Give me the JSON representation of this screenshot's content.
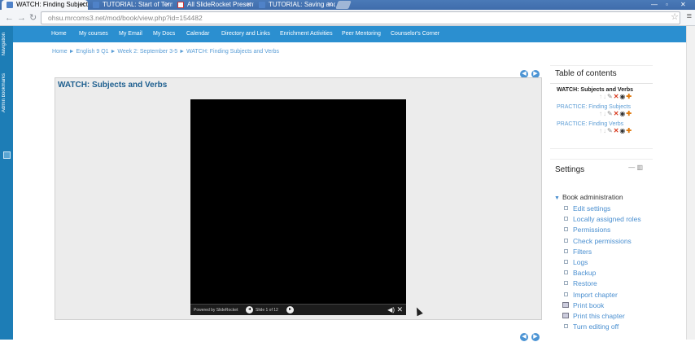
{
  "browser": {
    "tabs": [
      {
        "title": "WATCH: Finding Subjects",
        "favicon": "moodle-icon",
        "active": true
      },
      {
        "title": "TUTORIAL: Start of Term",
        "favicon": "moodle-icon",
        "active": false
      },
      {
        "title": "All SlideRocket Presentat",
        "favicon": "gmail-icon",
        "active": false
      },
      {
        "title": "TUTORIAL: Saving and",
        "favicon": "moodle-icon",
        "active": false
      }
    ],
    "url": "ohsu.mrcoms3.net/mod/book/view.php?id=154482"
  },
  "dock": {
    "navigation_label": "Navigation",
    "admin_label": "Admin bookmarks"
  },
  "sitenav": {
    "items": [
      "Home",
      "My courses",
      "My Email",
      "My Docs",
      "Calendar",
      "Directory and Links",
      "Enrichment Activities",
      "Peer Mentoring",
      "Counselor's Corner"
    ]
  },
  "breadcrumb": "Home ► English 9 Q1 ► Week 2: September 3-5 ► WATCH: Finding Subjects and Verbs",
  "content": {
    "title": "WATCH: Subjects and Verbs",
    "player": {
      "powered_by": "Powered by SlideRocket",
      "slide_counter": "Slide 1 of 12"
    }
  },
  "toc": {
    "title": "Table of contents",
    "chapters": [
      {
        "label": "WATCH: Subjects and Verbs",
        "current": true
      },
      {
        "label": "PRACTICE: Finding Subjects",
        "current": false
      },
      {
        "label": "PRACTICE: Finding Verbs",
        "current": false
      }
    ]
  },
  "settings": {
    "title": "Settings",
    "book_admin_label": "Book administration",
    "links": [
      "Edit settings",
      "Locally assigned roles",
      "Permissions",
      "Check permissions",
      "Filters",
      "Logs",
      "Backup",
      "Restore",
      "Import chapter",
      "Print book",
      "Print this chapter",
      "Turn editing off"
    ]
  }
}
